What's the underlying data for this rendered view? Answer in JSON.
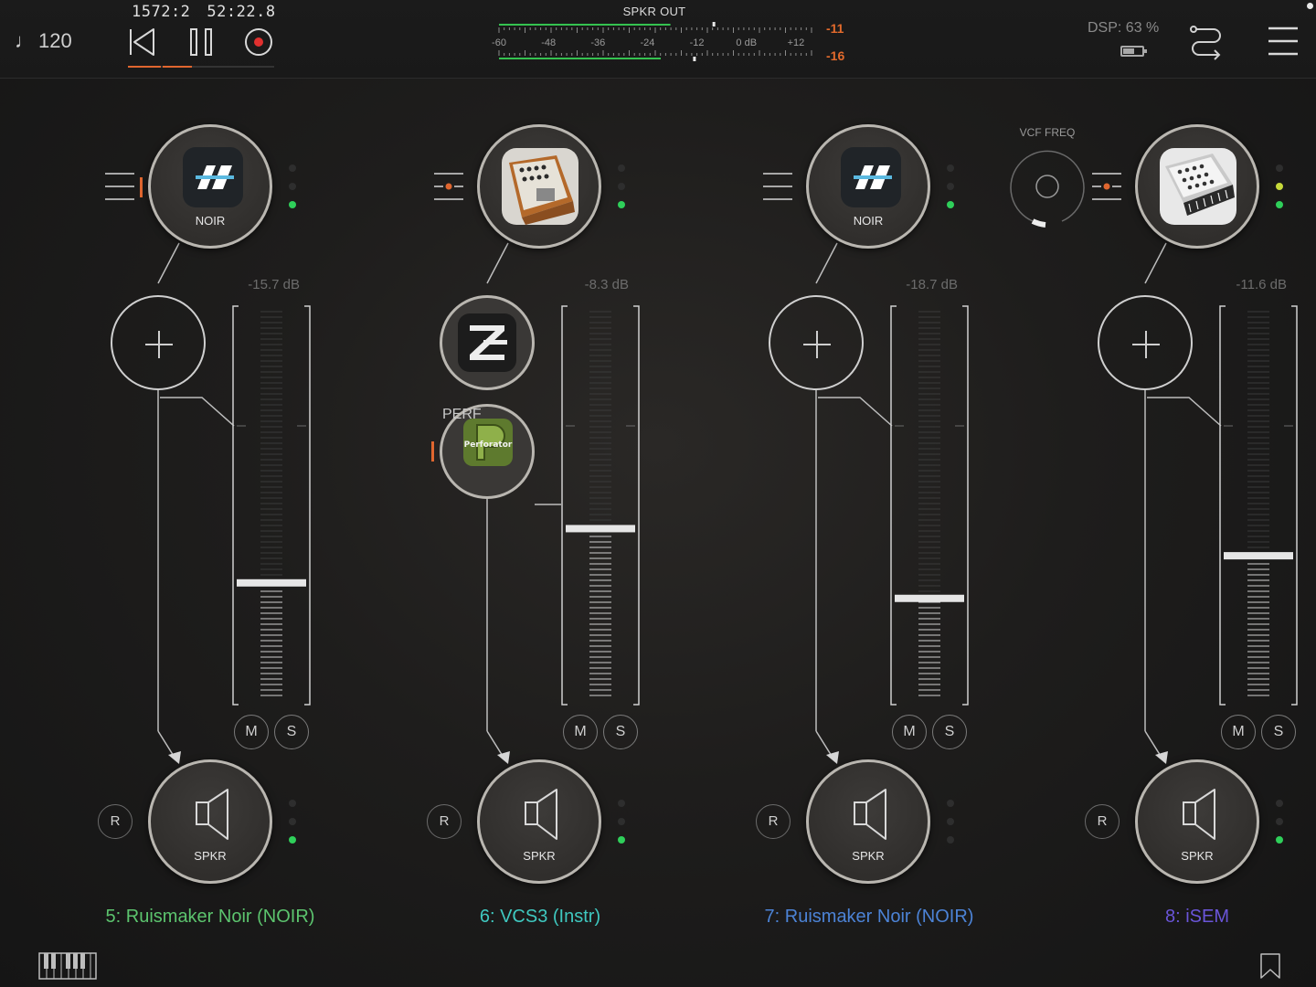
{
  "topbar": {
    "tempo": "120",
    "tempo_glyph": "♩",
    "bars_beats": "1572:2",
    "time": "52:22.8",
    "meter_title": "SPKR OUT",
    "meter_scale": [
      "-60",
      "-48",
      "-36",
      "-24",
      "-12",
      "0 dB",
      "+12"
    ],
    "meter_level_top": 0.53,
    "meter_level_bottom": 0.5,
    "peak_left": "-11",
    "peak_right": "-16",
    "dsp": "DSP: 63 %",
    "battery_level": 0.6,
    "accent_color": "#e0662f"
  },
  "channels": [
    {
      "source_label": "NOIR",
      "source_icon": "noir-logo-icon",
      "db": "-15.7 dB",
      "fader_level": 0.7,
      "mute": "M",
      "solo": "S",
      "record": "R",
      "output_label": "SPKR",
      "name": "5: Ruismaker Noir (NOIR)",
      "name_color": "#5cc46e"
    },
    {
      "source_label": "",
      "source_icon": "vcs3-synth-icon",
      "db": "-8.3 dB",
      "fader_level": 0.56,
      "effects": [
        {
          "label": "",
          "icon": "z-logo-icon"
        },
        {
          "label": "PERF",
          "icon": "perforator-icon",
          "icon_text": "Perforator"
        }
      ],
      "mute": "M",
      "solo": "S",
      "record": "R",
      "output_label": "SPKR",
      "name": "6: VCS3 (Instr)",
      "name_color": "#3fc8c0"
    },
    {
      "source_label": "NOIR",
      "source_icon": "noir-logo-icon",
      "db": "-18.7 dB",
      "fader_level": 0.74,
      "mute": "M",
      "solo": "S",
      "record": "R",
      "output_label": "SPKR",
      "name": "7: Ruismaker Noir (NOIR)",
      "name_color": "#4c83d6"
    },
    {
      "source_label": "",
      "source_icon": "isem-synth-icon",
      "db": "-11.6 dB",
      "fader_level": 0.63,
      "mute": "M",
      "solo": "S",
      "record": "R",
      "output_label": "SPKR",
      "name": "8: iSEM",
      "name_color": "#6a55d8"
    }
  ],
  "knob": {
    "label": "VCF FREQ",
    "value": 0.15
  }
}
